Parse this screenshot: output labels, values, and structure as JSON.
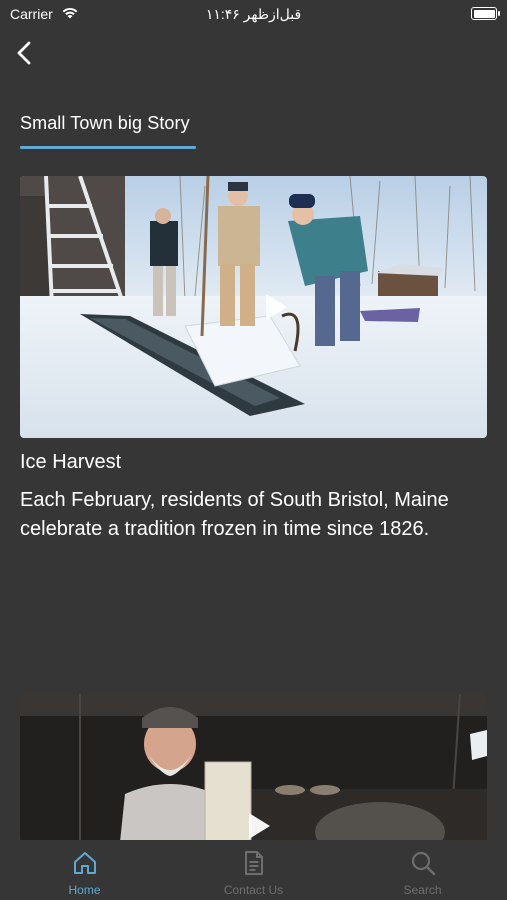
{
  "status_bar": {
    "carrier": "Carrier",
    "time": "۱۱:۴۶ قبل‌ازظهر",
    "battery_level": 1.0
  },
  "header": {
    "section_title": "Small Town big Story"
  },
  "articles": [
    {
      "title": "Ice Harvest",
      "description": "Each February, residents of South Bristol, Maine celebrate a tradition frozen in time since 1826."
    }
  ],
  "tab_bar": {
    "items": [
      {
        "label": "Home",
        "icon": "home-icon",
        "active": true
      },
      {
        "label": "Contact Us",
        "icon": "document-icon",
        "active": false
      },
      {
        "label": "Search",
        "icon": "search-icon",
        "active": false
      }
    ]
  },
  "colors": {
    "background": "#363636",
    "accent": "#5fa8d3",
    "tab_inactive": "#6e6e6e",
    "text": "#ffffff"
  }
}
